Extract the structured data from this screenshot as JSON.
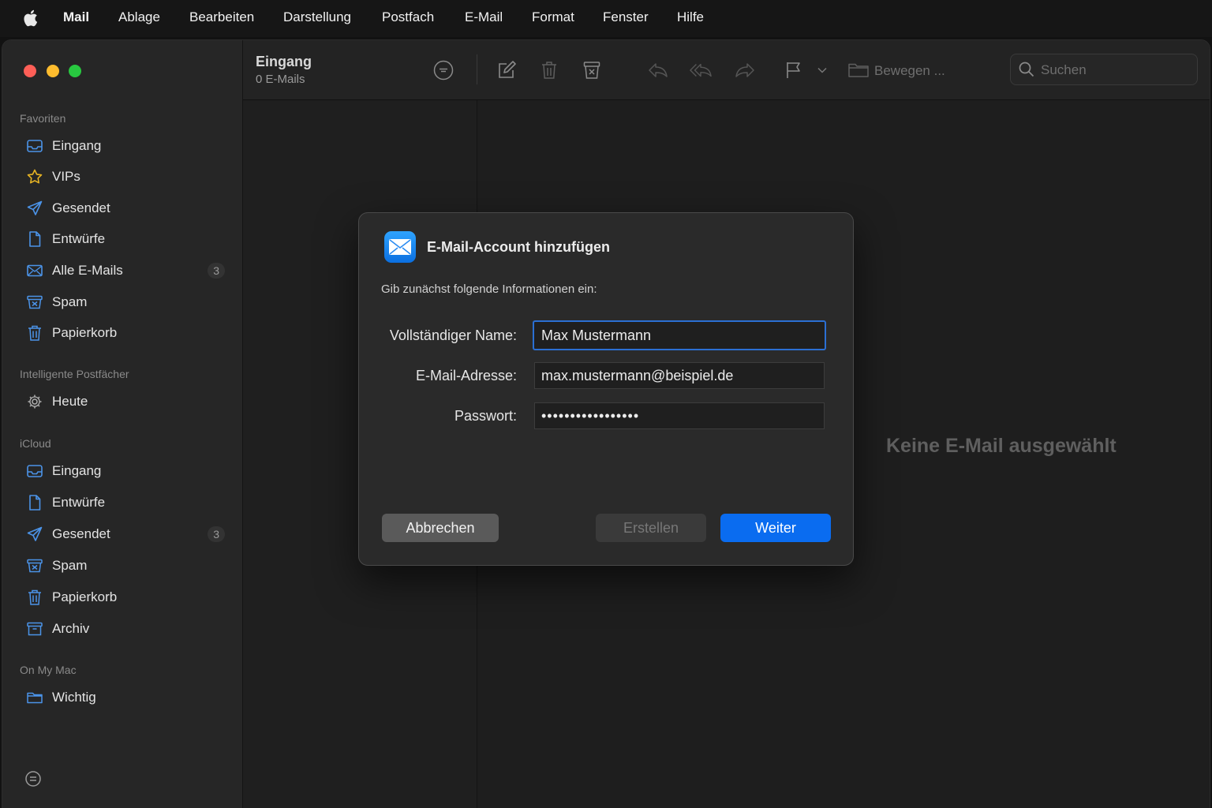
{
  "menubar": {
    "app": "Mail",
    "items": [
      "Ablage",
      "Bearbeiten",
      "Darstellung",
      "Postfach",
      "E-Mail",
      "Format",
      "Fenster",
      "Hilfe"
    ]
  },
  "sidebar": {
    "favorites_title": "Favoriten",
    "favorites": [
      {
        "label": "Eingang",
        "icon": "inbox-icon"
      },
      {
        "label": "VIPs",
        "icon": "star-icon"
      },
      {
        "label": "Gesendet",
        "icon": "paperplane-icon"
      },
      {
        "label": "Entwürfe",
        "icon": "document-icon"
      },
      {
        "label": "Alle E-Mails",
        "icon": "envelope-icon",
        "badge": "3"
      },
      {
        "label": "Spam",
        "icon": "junk-icon"
      },
      {
        "label": "Papierkorb",
        "icon": "trash-icon"
      }
    ],
    "smart_title": "Intelligente Postfächer",
    "smart": [
      {
        "label": "Heute",
        "icon": "gear-icon"
      }
    ],
    "icloud_title": "iCloud",
    "icloud": [
      {
        "label": "Eingang",
        "icon": "inbox-icon"
      },
      {
        "label": "Entwürfe",
        "icon": "document-icon"
      },
      {
        "label": "Gesendet",
        "icon": "paperplane-icon",
        "badge": "3"
      },
      {
        "label": "Spam",
        "icon": "junk-icon"
      },
      {
        "label": "Papierkorb",
        "icon": "trash-icon"
      },
      {
        "label": "Archiv",
        "icon": "archive-icon"
      }
    ],
    "onmymac_title": "On My Mac",
    "onmymac": [
      {
        "label": "Wichtig",
        "icon": "folder-icon"
      }
    ]
  },
  "toolbar": {
    "mailbox_title": "Eingang",
    "mailbox_count": "0 E-Mails",
    "move_label": "Bewegen ...",
    "search_placeholder": "Suchen"
  },
  "content": {
    "empty_message": "Keine E-Mail ausgewählt"
  },
  "dialog": {
    "title": "E-Mail-Account hinzufügen",
    "intro": "Gib zunächst folgende Informationen ein:",
    "name_label": "Vollständiger Name:",
    "name_value": "Max Mustermann",
    "email_label": "E-Mail-Adresse:",
    "email_value": "max.mustermann@beispiel.de",
    "password_label": "Passwort:",
    "password_value": "•••••••••••••••••",
    "cancel_label": "Abbrechen",
    "create_label": "Erstellen",
    "next_label": "Weiter"
  },
  "colors": {
    "accent": "#0a6cf0",
    "close": "#fe5f57",
    "minimize": "#febc2e",
    "zoom": "#28c840"
  }
}
